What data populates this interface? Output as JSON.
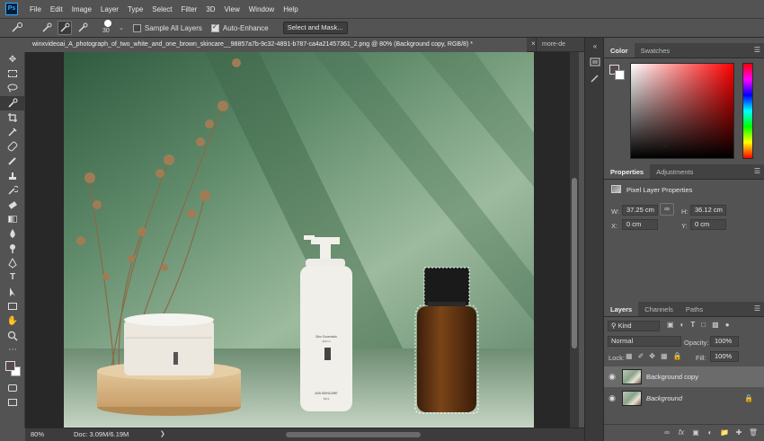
{
  "app": {
    "logo": "Ps"
  },
  "menu": [
    "File",
    "Edit",
    "Image",
    "Layer",
    "Type",
    "Select",
    "Filter",
    "3D",
    "View",
    "Window",
    "Help"
  ],
  "options": {
    "brush_size": "30",
    "sample_all_layers_label": "Sample All Layers",
    "sample_all_layers_checked": false,
    "auto_enhance_label": "Auto-Enhance",
    "auto_enhance_checked": true,
    "select_and_mask_label": "Select and Mask..."
  },
  "document": {
    "tab_title": "winxvideoai_A_photograph_of_two_white_and_one_brown_skincare__98857a7b-9c32-4891-b787-ca4a21457361_2.png @ 80% (Background copy, RGB/8) *",
    "close": "×",
    "second_tab": "more-de"
  },
  "canvas_product_labels": {
    "bottle_line1": "Skin Essentials",
    "bottle_line2": "300 ml",
    "bottle_line3": "AVA SKINCARE",
    "bottle_line4": "50ml"
  },
  "status": {
    "zoom": "80%",
    "doc": "Doc: 3.09M/6.19M"
  },
  "color_panel": {
    "tabs": [
      "Color",
      "Swatches"
    ],
    "foreground": "#584a4a",
    "background": "#ffffff"
  },
  "properties_panel": {
    "tabs": [
      "Properties",
      "Adjustments"
    ],
    "heading": "Pixel Layer Properties",
    "w_label": "W:",
    "w_value": "37.25 cm",
    "h_label": "H:",
    "h_value": "36.12 cm",
    "x_label": "X:",
    "x_value": "0 cm",
    "y_label": "Y:",
    "y_value": "0 cm"
  },
  "layers_panel": {
    "tabs": [
      "Layers",
      "Channels",
      "Paths"
    ],
    "kind_label": "Kind",
    "blend_mode": "Normal",
    "opacity_label": "Opacity:",
    "opacity_value": "100%",
    "lock_label": "Lock:",
    "fill_label": "Fill:",
    "fill_value": "100%",
    "layers": [
      {
        "name": "Background copy",
        "selected": true,
        "visible": true
      },
      {
        "name": "Background",
        "selected": false,
        "visible": true,
        "locked": true
      }
    ]
  }
}
